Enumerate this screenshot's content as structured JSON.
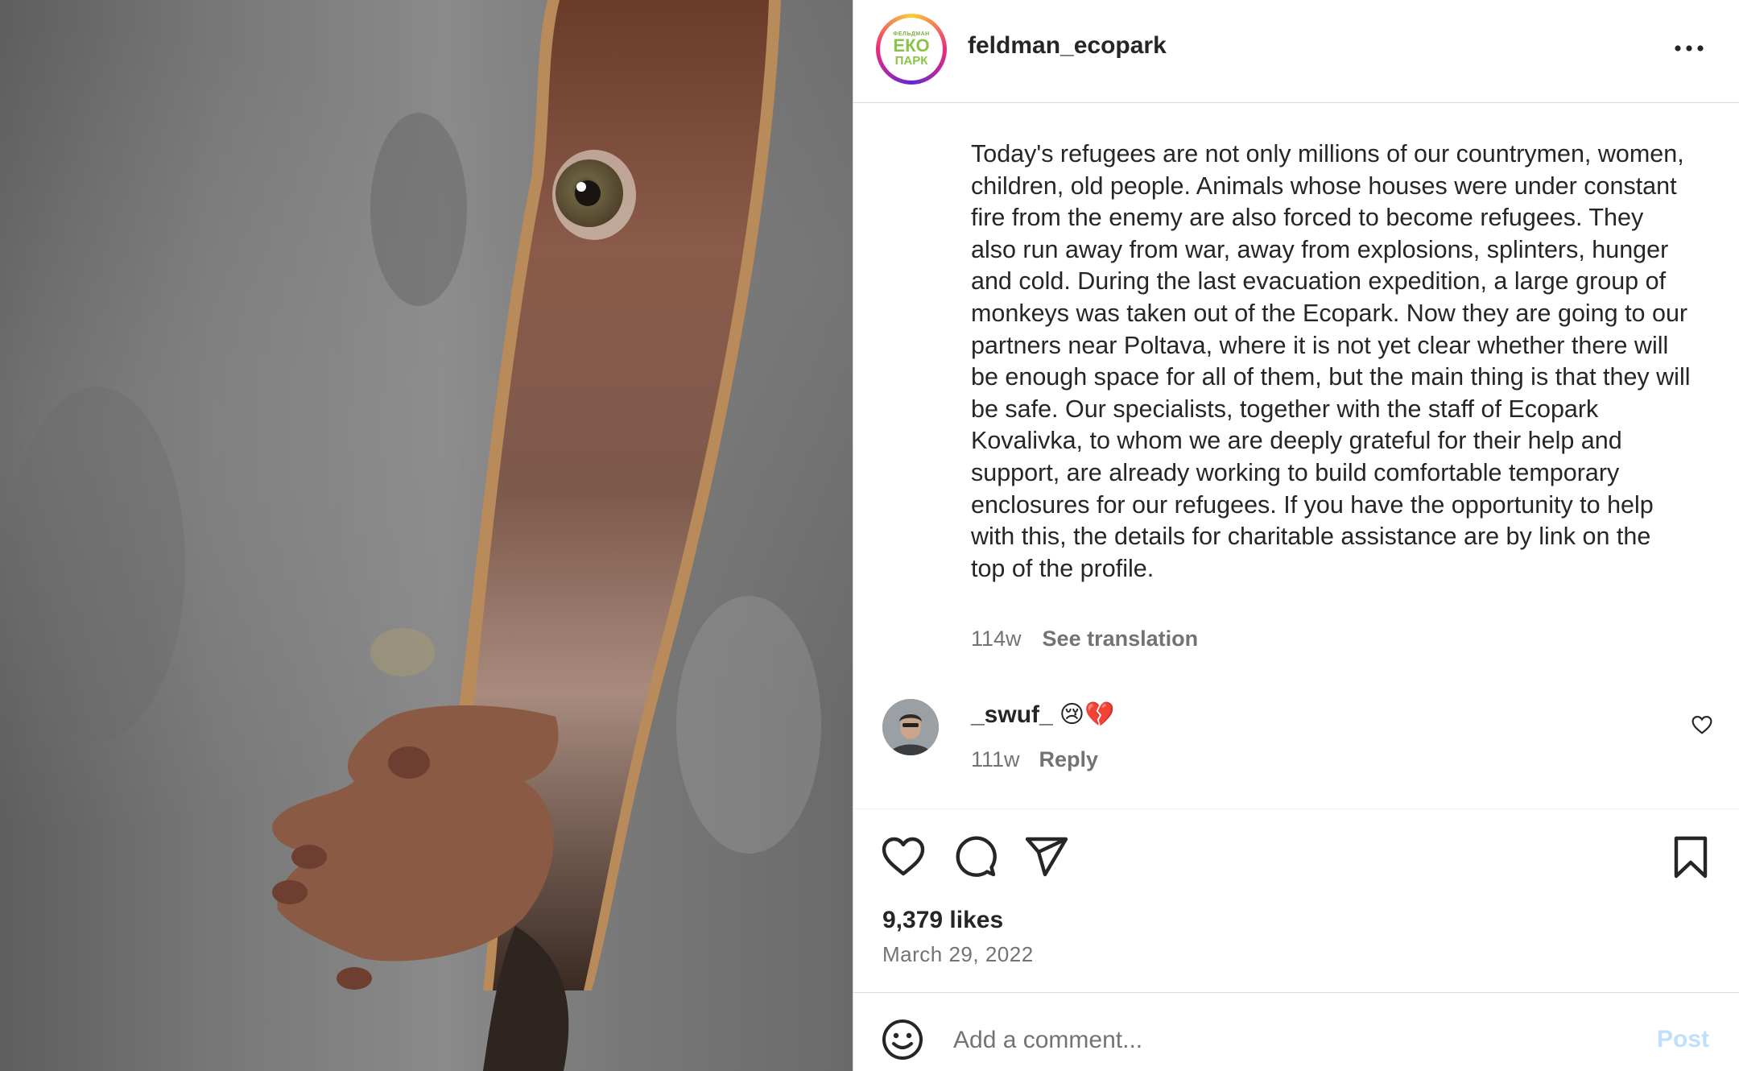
{
  "photo": {
    "icon": "monkey-peeking-photo"
  },
  "header": {
    "username": "feldman_ecopark",
    "avatar_logo": {
      "top": "ФЕЛЬДМАН",
      "middle": "ЕКО",
      "bottom": "ПАРК"
    },
    "more_icon": "more-horizontal-icon"
  },
  "caption": {
    "text": "Today's refugees are not only millions of our countrymen, women, children, old people. Animals whose houses were under constant fire from the enemy are also forced to become refugees. They also run away from war, away from explosions, splinters, hunger and cold. During the last evacuation expedition, a large group of monkeys was taken out of the Ecopark. Now they are going to our partners near Poltava, where it is not yet clear whether there will be enough space for all of them, but the main thing is that they will be safe. Our specialists, together with the staff of Ecopark Kovalivka, to whom we are deeply grateful for their help and support, are already working to build comfortable temporary enclosures for our refugees. If you have the opportunity to help with this, the details for charitable assistance are by link on the top of the profile.",
    "age": "114w",
    "see_translation": "See translation"
  },
  "comment": {
    "username": "_swuf_",
    "text": "😢💔",
    "age": "111w",
    "reply": "Reply",
    "like_icon": "heart-outline-icon"
  },
  "actions": {
    "icons": [
      "heart-icon",
      "comment-icon",
      "share-icon",
      "bookmark-icon"
    ],
    "likes": "9,379 likes",
    "date": "March 29, 2022"
  },
  "add_comment": {
    "emoji_icon": "emoji-icon",
    "placeholder": "Add a comment...",
    "post_label": "Post"
  },
  "colors": {
    "text_primary": "#262626",
    "text_secondary": "#737373",
    "post_disabled": "#c0dffd",
    "border": "#dbdbdb"
  }
}
